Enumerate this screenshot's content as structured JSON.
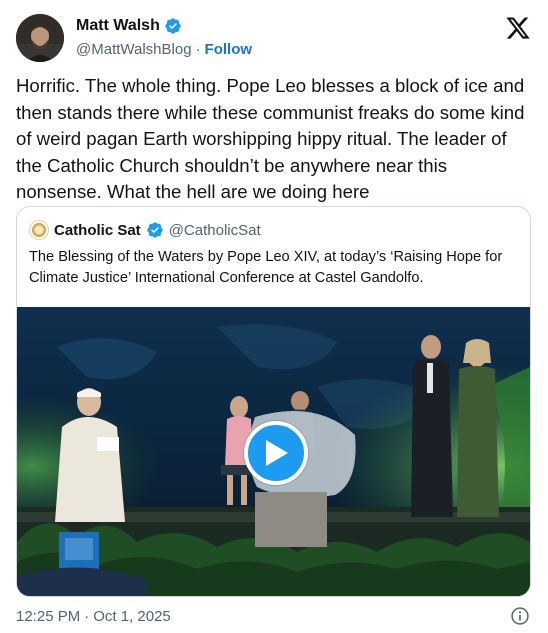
{
  "author": {
    "display_name": "Matt Walsh",
    "handle": "@MattWalshBlog",
    "separator": "·",
    "follow_label": "Follow",
    "verified": true
  },
  "tweet": {
    "text": "Horrific. The whole thing. Pope Leo blesses a block of ice and then stands there while these communist freaks do some kind of weird pagan Earth worshipping hippy ritual. The leader of the Catholic Church shouldn’t be anywhere near this nonsense. What the hell are we doing here"
  },
  "quoted": {
    "display_name": "Catholic Sat",
    "handle": "@CatholicSat",
    "verified": true,
    "text": "The Blessing of the Waters by Pope Leo XIV, at today’s ‘Raising Hope for Climate Justice’ International Conference at Castel Gandolfo."
  },
  "footer": {
    "time": "12:25 PM",
    "separator": "·",
    "date": "Oct 1, 2025"
  },
  "colors": {
    "accent": "#1d9bf0",
    "follow": "#1d74c0",
    "muted": "#536471",
    "border": "#cfd9de"
  },
  "icons": [
    "x-logo-icon",
    "verified-badge-icon",
    "play-icon",
    "info-icon"
  ]
}
